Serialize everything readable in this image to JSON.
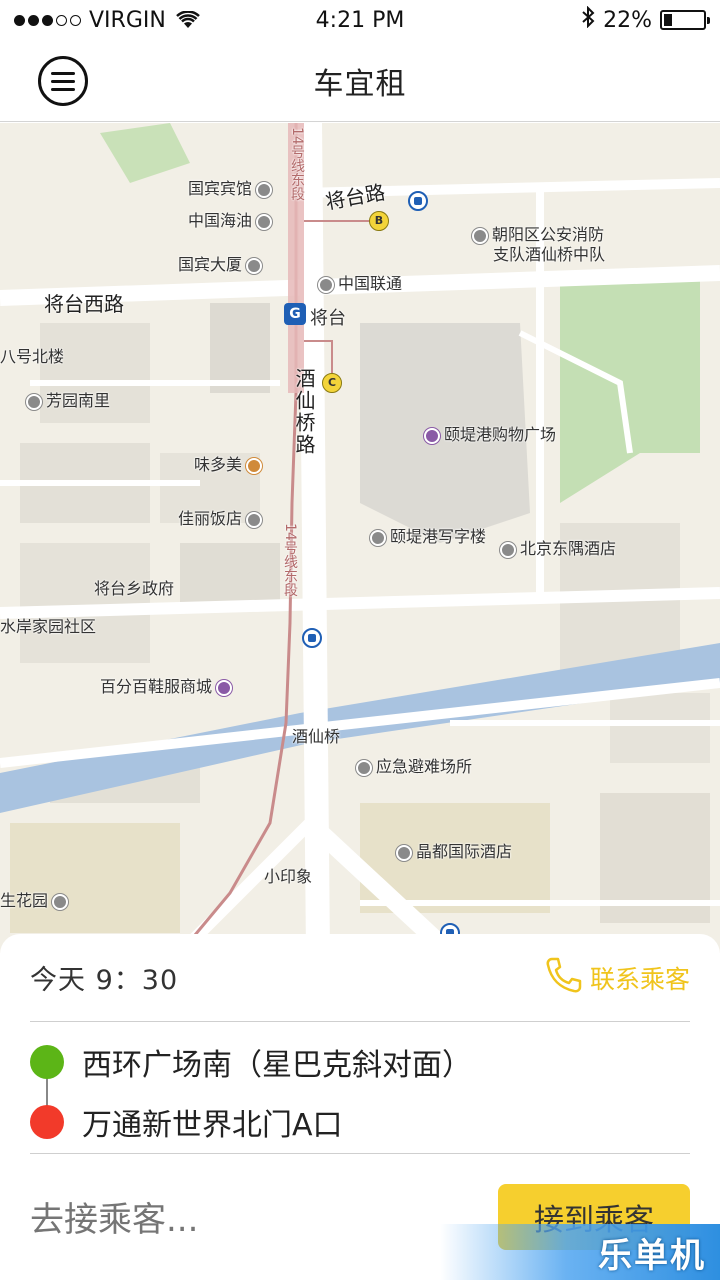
{
  "status_bar": {
    "carrier": "VIRGIN",
    "time": "4:21 PM",
    "battery": "22%",
    "battery_level": 0.22
  },
  "header": {
    "title": "车宜租"
  },
  "map": {
    "labels": {
      "jiangtai_road": "将台路",
      "jiangtai_west_road": "将台西路",
      "jiuxianqiao_road": "酒仙桥路",
      "line14_north": "14号线东段",
      "line14_south": "14号线东段",
      "guobin_hotel": "国宾宾馆",
      "cnooc": "中国海油",
      "guobin_mansion": "国宾大厦",
      "china_unicom": "中国联通",
      "jiangtai_station": "将台",
      "fire_brigade_line1": "朝阳区公安消防",
      "fire_brigade_line2": "支队酒仙桥中队",
      "bahao_beilou": "八号北楼",
      "fangyuan_nanli": "芳园南里",
      "indigo_mall": "颐堤港购物广场",
      "weiduomei": "味多美",
      "jiali_hotel": "佳丽饭店",
      "indigo_office": "颐堤港写字楼",
      "east_hotel": "北京东隅酒店",
      "jiangtai_gov": "将台乡政府",
      "shuian_community": "水岸家园社区",
      "baifenbai_mall": "百分百鞋服商城",
      "jiuxianqiao": "酒仙桥",
      "shelter": "应急避难场所",
      "jingdu_hotel": "晶都国际酒店",
      "xiaoyinxiang": "小印象",
      "shenghuayuan": "生花园"
    },
    "exits": [
      "B",
      "C"
    ]
  },
  "order": {
    "time": "今天 9：30",
    "contact_label": "联系乘客",
    "from": "西环广场南（星巴克斜对面）",
    "to": "万通新世界北门A口",
    "message_placeholder": "去接乘客...",
    "pickup_button": "接到乘客"
  },
  "watermark": "乐单机"
}
